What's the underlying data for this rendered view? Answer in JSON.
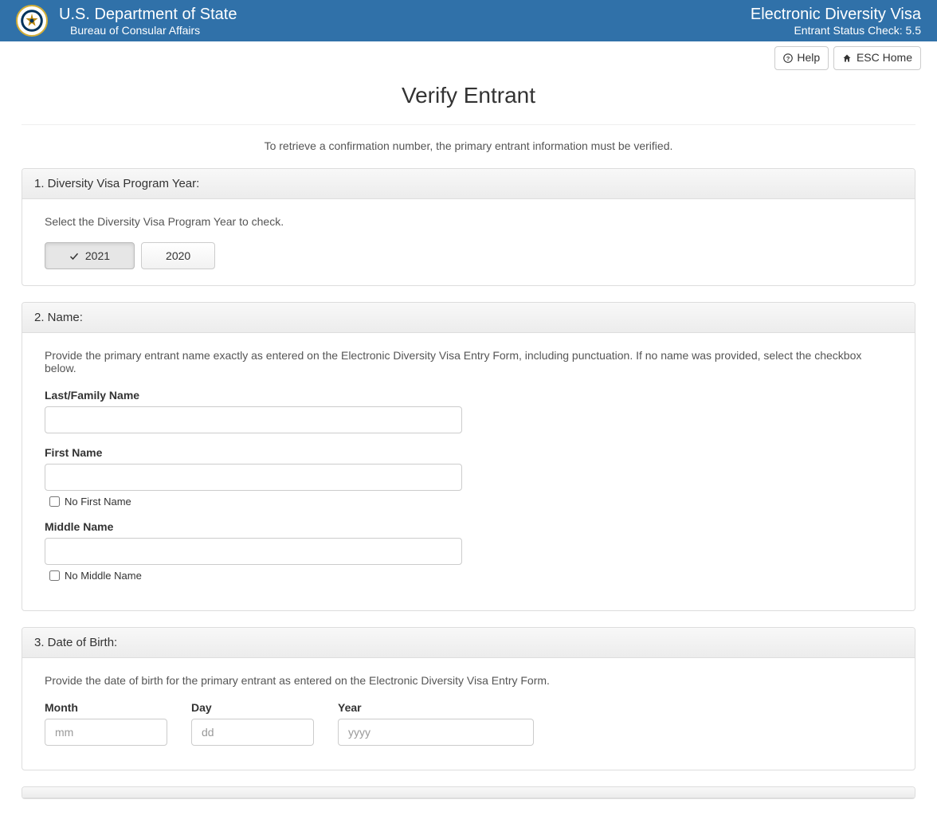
{
  "header": {
    "department": "U.S. Department of State",
    "bureau": "Bureau of Consular Affairs",
    "app_title": "Electronic Diversity Visa",
    "subtitle": "Entrant Status Check: 5.5"
  },
  "topbuttons": {
    "help": "Help",
    "esc_home": "ESC Home"
  },
  "page": {
    "title": "Verify Entrant",
    "intro": "To retrieve a confirmation number, the primary entrant information must be verified."
  },
  "panel1": {
    "heading": "1. Diversity Visa Program Year:",
    "desc": "Select the Diversity Visa Program Year to check.",
    "year_active": "2021",
    "year_other": "2020"
  },
  "panel2": {
    "heading": "2. Name:",
    "desc": "Provide the primary entrant name exactly as entered on the Electronic Diversity Visa Entry Form, including punctuation. If no name was provided, select the checkbox below.",
    "last_label": "Last/Family Name",
    "first_label": "First Name",
    "no_first": "No First Name",
    "middle_label": "Middle Name",
    "no_middle": "No Middle Name"
  },
  "panel3": {
    "heading": "3. Date of Birth:",
    "desc": "Provide the date of birth for the primary entrant as entered on the Electronic Diversity Visa Entry Form.",
    "month_label": "Month",
    "month_ph": "mm",
    "day_label": "Day",
    "day_ph": "dd",
    "year_label": "Year",
    "year_ph": "yyyy"
  }
}
